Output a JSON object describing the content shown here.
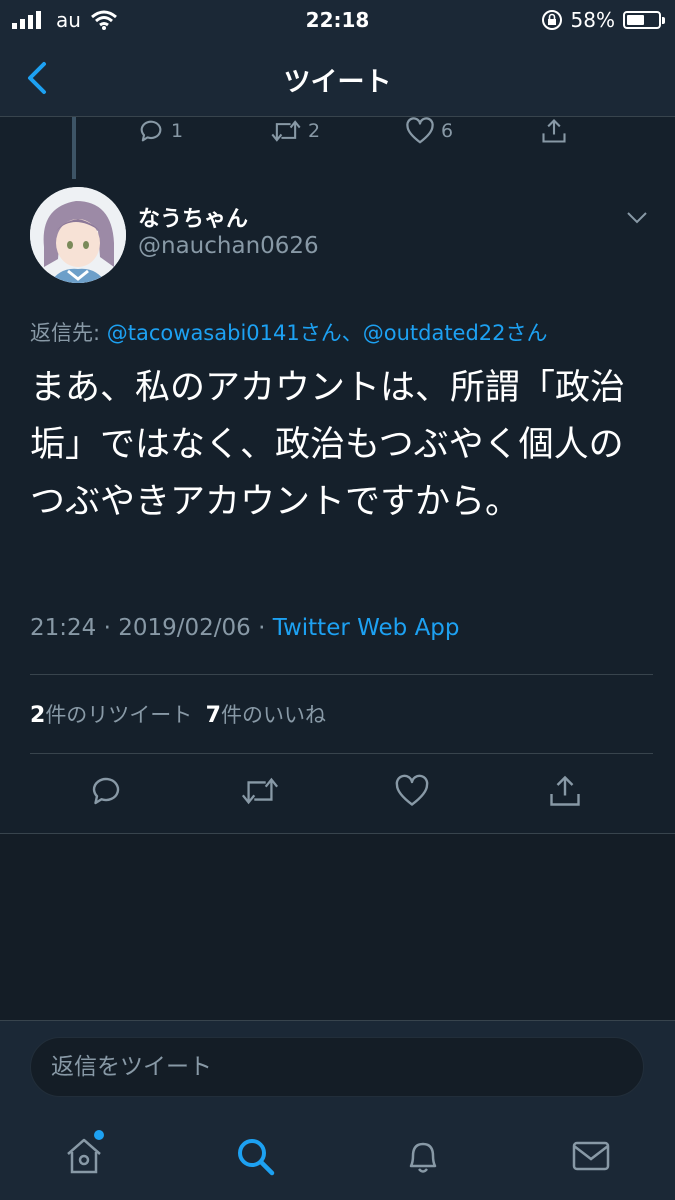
{
  "status_bar": {
    "carrier": "au",
    "time": "22:18",
    "battery_percent": "58%",
    "battery_level": 0.58
  },
  "nav": {
    "title": "ツイート"
  },
  "previous_tweet_actions": {
    "reply_count": "1",
    "retweet_count": "2",
    "like_count": "6"
  },
  "tweet": {
    "display_name": "なうちゃん",
    "handle": "@nauchan0626",
    "reply_prefix": "返信先: ",
    "reply_to_1": "@tacowasabi0141さん",
    "reply_separator": "、",
    "reply_to_2": "@outdated22さん",
    "text": "まあ、私のアカウントは、所謂「政治垢」ではなく、政治もつぶやく個人のつぶやきアカウントですから。",
    "time": "21:24 · 2019/02/06 · ",
    "source": "Twitter Web App",
    "retweet_count": "2",
    "retweet_label": "件のリツイート",
    "like_count": "7",
    "like_label": "件のいいね"
  },
  "reply_bar": {
    "placeholder": "返信をツイート"
  },
  "colors": {
    "accent": "#1da1f2",
    "background": "#15202b",
    "secondary_text": "#8899a6"
  },
  "icons": [
    "signal-icon",
    "wifi-icon",
    "lock-rotation-icon",
    "battery-icon",
    "back-icon",
    "reply-icon",
    "retweet-icon",
    "like-icon",
    "share-icon",
    "chevron-down-icon",
    "home-icon",
    "search-icon",
    "notifications-icon",
    "messages-icon"
  ]
}
